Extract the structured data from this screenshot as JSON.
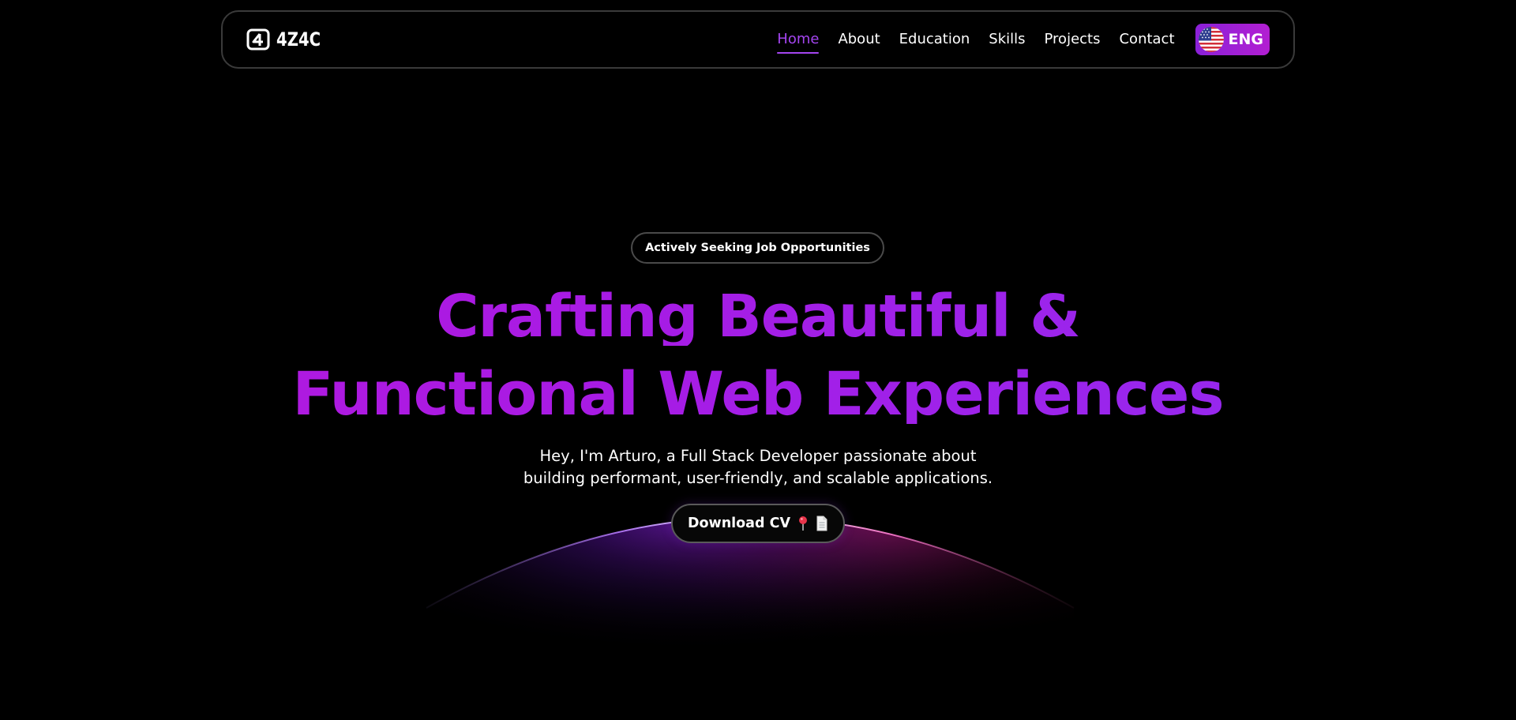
{
  "nav": {
    "logo_text": "4Z4C",
    "links": [
      {
        "label": "Home",
        "active": true
      },
      {
        "label": "About",
        "active": false
      },
      {
        "label": "Education",
        "active": false
      },
      {
        "label": "Skills",
        "active": false
      },
      {
        "label": "Projects",
        "active": false
      },
      {
        "label": "Contact",
        "active": false
      }
    ],
    "language": {
      "label": "ENG",
      "flag_icon": "us-flag-icon"
    }
  },
  "hero": {
    "badge": "Actively Seeking Job Opportunities",
    "headline_line1": "Crafting Beautiful &",
    "headline_line2": "Functional Web Experiences",
    "subtitle_line1": "Hey, I'm Arturo, a Full Stack Developer passionate about",
    "subtitle_line2": "building performant, user-friendly, and scalable applications.",
    "cta_label": "Download CV",
    "cta_icons": [
      "pin-icon",
      "document-icon"
    ]
  },
  "colors": {
    "accent": "#a445f0",
    "headline_gradient_start": "#b419dd",
    "headline_gradient_end": "#8f2df2",
    "language_button": "#9a20d6",
    "background": "#000000"
  }
}
